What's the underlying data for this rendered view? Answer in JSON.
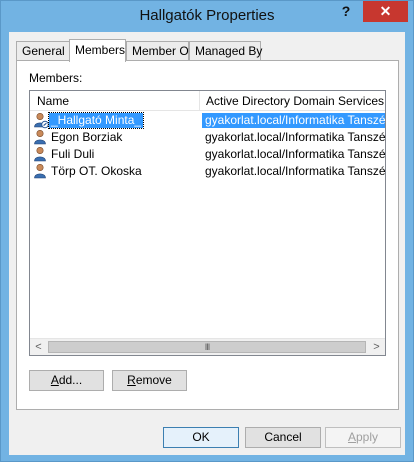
{
  "window": {
    "title": "Hallgatók Properties",
    "help_label": "?",
    "close_label": "✕"
  },
  "tabs": [
    {
      "label": "General",
      "active": false
    },
    {
      "label": "Members",
      "active": true
    },
    {
      "label": "Member Of",
      "active": false
    },
    {
      "label": "Managed By",
      "active": false
    }
  ],
  "members": {
    "label": "Members:",
    "columns": [
      "Name",
      "Active Directory Domain Services Fo"
    ],
    "rows": [
      {
        "name": "_Hallgató Minta_",
        "folder": "gyakorlat.local/Informatika Tanszék",
        "icon": "disabled-user-icon",
        "selected": true
      },
      {
        "name": "Egon Borziak",
        "folder": "gyakorlat.local/Informatika Tanszék",
        "icon": "user-icon",
        "selected": false
      },
      {
        "name": "Fuli Duli",
        "folder": "gyakorlat.local/Informatika Tanszék",
        "icon": "user-icon",
        "selected": false
      },
      {
        "name": "Törp OT. Okoska",
        "folder": "gyakorlat.local/Informatika Tanszék",
        "icon": "user-icon",
        "selected": false
      }
    ],
    "scroll_left": "<",
    "scroll_right": ">",
    "scroll_grip": "III"
  },
  "buttons": {
    "add_first": "A",
    "add_rest": "dd...",
    "remove_first": "R",
    "remove_rest": "emove",
    "ok": "OK",
    "cancel": "Cancel",
    "apply_first": "A",
    "apply_rest": "pply"
  },
  "colors": {
    "title_bar": "#72b3e3",
    "close_button": "#c7372f",
    "selection": "#3399ff"
  }
}
